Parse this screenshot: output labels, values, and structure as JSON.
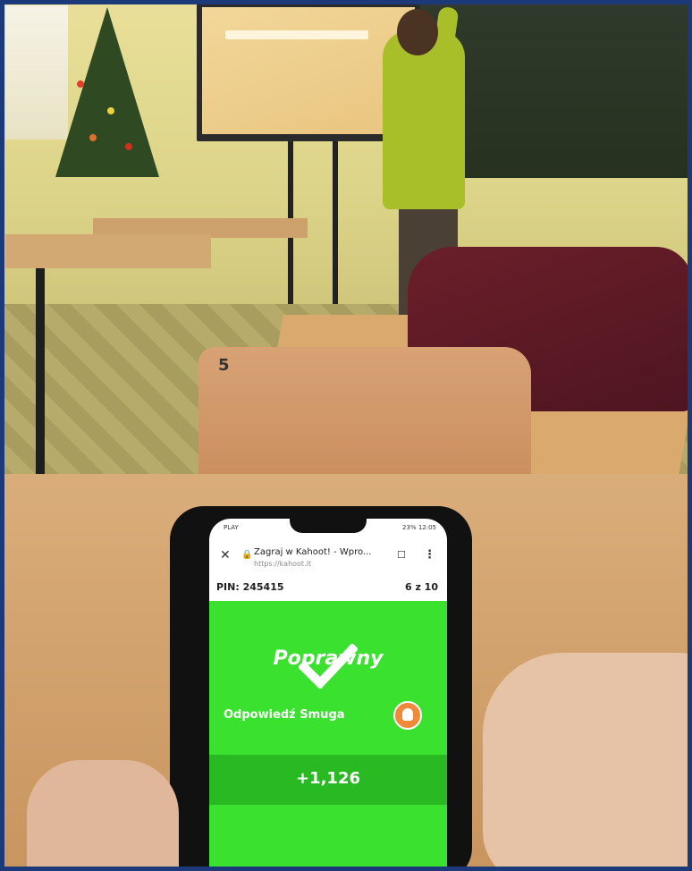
{
  "phone": {
    "status_left": "PLAY",
    "status_right": "23% 12:05",
    "browser": {
      "title": "Zagraj w Kahoot! - Wpro...",
      "url": "https://kahoot.it"
    },
    "game": {
      "pin": "PIN: 245415",
      "progress": "6 z 10",
      "result": "Poprawny",
      "answer_label": "Odpowiedź Smuga",
      "points": "+1,126"
    }
  },
  "scene": {
    "chair_number": "5"
  },
  "colors": {
    "kahoot_green": "#3ae12f",
    "points_bar": "#29b923",
    "frame": "#1c3a7a"
  },
  "icons": [
    "close-icon",
    "lock-icon",
    "bookmark-icon",
    "more-icon",
    "check-icon",
    "avatar-icon"
  ]
}
